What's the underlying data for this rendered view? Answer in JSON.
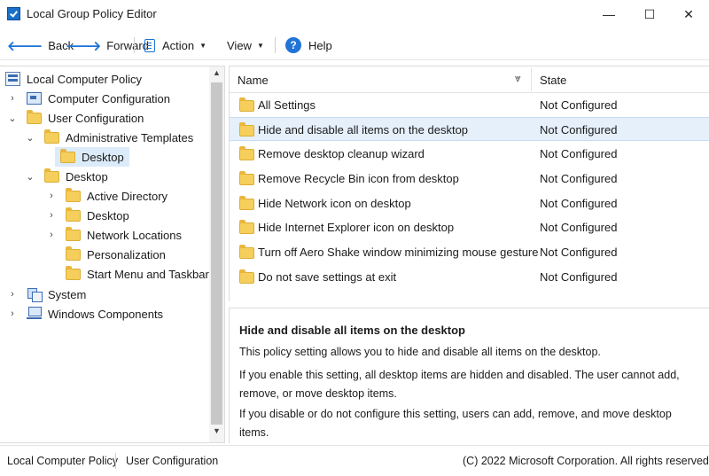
{
  "window": {
    "title": "Local Group Policy Editor",
    "controls": {
      "minimize": "—",
      "maximize": "☐",
      "close": "✕"
    }
  },
  "toolbar": {
    "back": "Back",
    "forward": "Forward",
    "action": "Action",
    "view": "View",
    "help": "Help",
    "help_glyph": "?",
    "caret": "▼"
  },
  "tree": {
    "root": "Local Computer Policy",
    "computer_configuration": "Computer Configuration",
    "user_configuration": "User Configuration",
    "administrative_templates": "Administrative Templates",
    "desktop_selected": "Desktop",
    "desktop_group": "Desktop",
    "desktop_children": [
      "Active Directory",
      "Desktop",
      "Network Locations",
      "Personalization",
      "Start Menu and Taskbar"
    ],
    "system": "System",
    "windows_components": "Windows Components",
    "chevron_right": "›",
    "chevron_down": "⌄"
  },
  "list": {
    "columns": {
      "name": "Name",
      "sort_glyph": "⩔",
      "state": "State"
    },
    "rows": [
      {
        "name": "All Settings",
        "state": "Not Configured"
      },
      {
        "name": "Hide and disable all items on the desktop",
        "state": "Not Configured",
        "selected": true
      },
      {
        "name": "Remove desktop cleanup wizard",
        "state": "Not Configured"
      },
      {
        "name": "Remove Recycle Bin icon from desktop",
        "state": "Not Configured"
      },
      {
        "name": "Hide Network icon on desktop",
        "state": "Not Configured"
      },
      {
        "name": "Hide Internet Explorer icon on desktop",
        "state": "Not Configured"
      },
      {
        "name": "Turn off Aero Shake window minimizing mouse gesture",
        "state": "Not Configured"
      },
      {
        "name": "Do not save settings at exit",
        "state": "Not Configured"
      }
    ]
  },
  "description": {
    "title": "Hide and disable all items on the desktop",
    "p1": "This policy setting allows you to hide and disable all items on the desktop.",
    "p2": "If you enable this setting, all desktop items are hidden and disabled. The user cannot add, remove, or move desktop items.",
    "p3": "If you disable or do not configure this setting, users can add, remove, and move desktop items."
  },
  "statusbar": {
    "left": "Local Computer Policy",
    "middle": "User Configuration",
    "right": "(C) 2022 Microsoft Corporation. All rights reserved."
  }
}
